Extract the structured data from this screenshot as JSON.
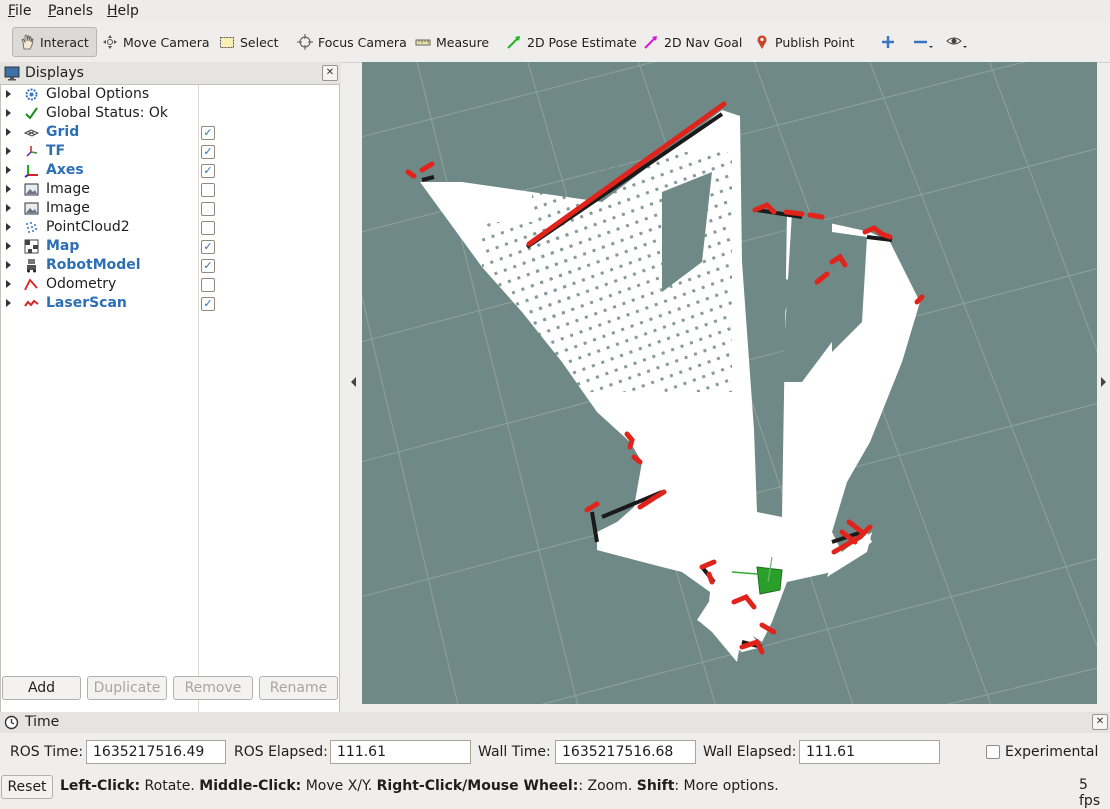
{
  "menu": {
    "file": "File",
    "panels": "Panels",
    "help": "Help"
  },
  "toolbar": {
    "interact": "Interact",
    "move_camera": "Move Camera",
    "select": "Select",
    "focus_camera": "Focus Camera",
    "measure": "Measure",
    "pose_estimate": "2D Pose Estimate",
    "nav_goal": "2D Nav Goal",
    "publish_point": "Publish Point"
  },
  "displays": {
    "title": "Displays",
    "items": [
      {
        "label": "Global Options",
        "checked": null,
        "bold": false,
        "icon": "gear-icon"
      },
      {
        "label": "Global Status: Ok",
        "checked": null,
        "bold": false,
        "icon": "check-icon"
      },
      {
        "label": "Grid",
        "checked": true,
        "bold": true,
        "icon": "grid-icon"
      },
      {
        "label": "TF",
        "checked": true,
        "bold": true,
        "icon": "tf-icon"
      },
      {
        "label": "Axes",
        "checked": true,
        "bold": true,
        "icon": "axes-icon"
      },
      {
        "label": "Image",
        "checked": false,
        "bold": false,
        "icon": "image-icon"
      },
      {
        "label": "Image",
        "checked": false,
        "bold": false,
        "icon": "image-icon"
      },
      {
        "label": "PointCloud2",
        "checked": false,
        "bold": false,
        "icon": "pointcloud-icon"
      },
      {
        "label": "Map",
        "checked": true,
        "bold": true,
        "icon": "map-icon"
      },
      {
        "label": "RobotModel",
        "checked": true,
        "bold": true,
        "icon": "robot-icon"
      },
      {
        "label": "Odometry",
        "checked": false,
        "bold": false,
        "icon": "odometry-icon"
      },
      {
        "label": "LaserScan",
        "checked": true,
        "bold": true,
        "icon": "laserscan-icon"
      }
    ],
    "buttons": {
      "add": "Add",
      "duplicate": "Duplicate",
      "remove": "Remove",
      "rename": "Rename"
    }
  },
  "time": {
    "title": "Time",
    "ros_time_label": "ROS Time:",
    "ros_time": "1635217516.49",
    "ros_elapsed_label": "ROS Elapsed:",
    "ros_elapsed": "111.61",
    "wall_time_label": "Wall Time:",
    "wall_time": "1635217516.68",
    "wall_elapsed_label": "Wall Elapsed:",
    "wall_elapsed": "111.61",
    "experimental": "Experimental"
  },
  "status": {
    "reset": "Reset",
    "left_click": "Left-Click:",
    "left_click_action": " Rotate. ",
    "middle_click": "Middle-Click:",
    "middle_click_action": " Move X/Y. ",
    "right_click": "Right-Click/Mouse Wheel:",
    "right_click_action": ": Zoom. ",
    "shift": "Shift",
    "shift_action": ": More options.",
    "fps": "5 fps"
  },
  "colors": {
    "background": "#6f8a86",
    "laser": "#e0231b",
    "free_space": "#ffffff",
    "obstacle": "#1a1a1a",
    "robot": "#2aa02a",
    "accent": "#2c6fb5"
  }
}
